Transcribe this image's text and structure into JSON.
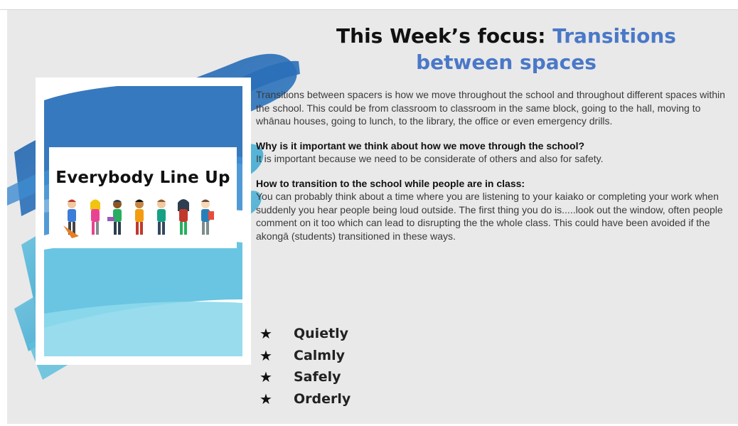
{
  "heading": {
    "prefix": "This Week’s focus:",
    "accent": "Transitions between spaces"
  },
  "poster": {
    "title": "Everybody Line Up"
  },
  "intro": "Transitions between spacers is how we move throughout the school and throughout different spaces within the school. This could be from classroom to classroom in the same block, going to the hall, moving to whānau houses, going to lunch, to the library, the office or even emergency drills.",
  "sections": [
    {
      "question": "Why is it important we think about how we move through the school?",
      "answer": "It is important because we need to be considerate of others and also for safety."
    },
    {
      "question": "How to transition to the school while people are in class:",
      "answer": "You can probably think about a time where you are listening to your kaiako or completing your work when suddenly you hear people being loud outside. The first thing you do is.....look out the window, often people comment on it too which can lead to disrupting the the whole class. This could have been avoided if the akongā (students) transitioned in these ways."
    }
  ],
  "bullets": [
    {
      "icon": "star-icon",
      "glyph": "★",
      "label": "Quietly"
    },
    {
      "icon": "star-icon",
      "glyph": "★",
      "label": "Calmly"
    },
    {
      "icon": "star-icon",
      "glyph": "★",
      "label": "Safely"
    },
    {
      "icon": "star-icon",
      "glyph": "★",
      "label": "Orderly"
    }
  ],
  "colors": {
    "accent": "#4a78c8",
    "background": "#e9e9e9",
    "brush_dark": "#2b6fb6",
    "brush_light": "#6ec3dc"
  }
}
